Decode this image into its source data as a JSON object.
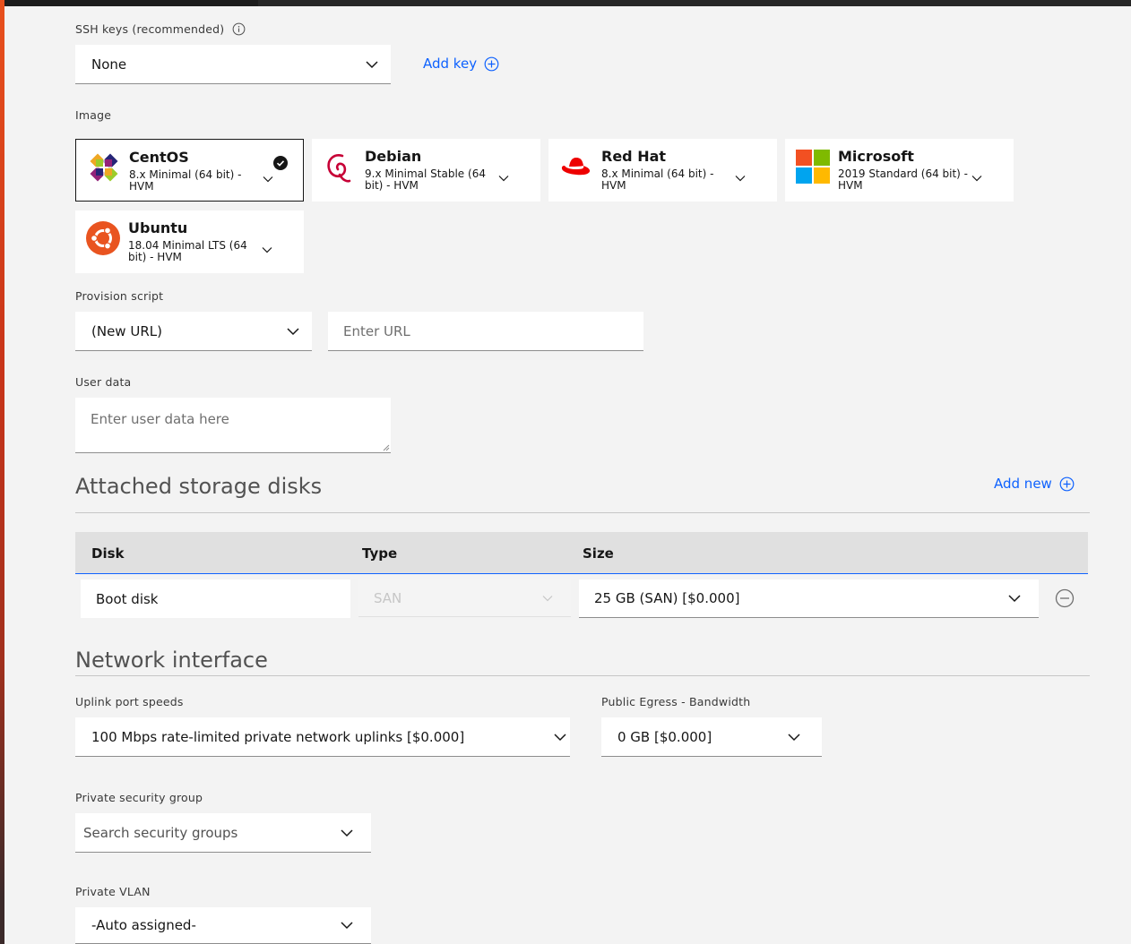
{
  "ssh": {
    "label": "SSH keys (recommended)",
    "value": "None",
    "add_key": "Add key"
  },
  "image": {
    "label": "Image",
    "options": [
      {
        "name": "CentOS",
        "desc": "8.x Minimal (64 bit) - HVM",
        "selected": true
      },
      {
        "name": "Debian",
        "desc": "9.x Minimal Stable (64 bit) - HVM",
        "selected": false
      },
      {
        "name": "Red Hat",
        "desc": "8.x Minimal (64 bit) - HVM",
        "selected": false
      },
      {
        "name": "Microsoft",
        "desc": "2019 Standard (64 bit) - HVM",
        "selected": false
      },
      {
        "name": "Ubuntu",
        "desc": "18.04 Minimal LTS (64 bit) - HVM",
        "selected": false
      }
    ]
  },
  "provision": {
    "label": "Provision script",
    "value": "(New URL)",
    "url_placeholder": "Enter URL"
  },
  "user_data": {
    "label": "User data",
    "placeholder": "Enter user data here"
  },
  "storage": {
    "title": "Attached storage disks",
    "add_new": "Add new",
    "columns": [
      "Disk",
      "Type",
      "Size"
    ],
    "rows": [
      {
        "disk": "Boot disk",
        "type": "SAN",
        "size": "25 GB (SAN) [$0.000]"
      }
    ]
  },
  "network": {
    "title": "Network interface",
    "uplink_label": "Uplink port speeds",
    "uplink_value": "100 Mbps rate-limited private network uplinks [$0.000]",
    "egress_label": "Public Egress - Bandwidth",
    "egress_value": "0 GB [$0.000]",
    "security_label": "Private security group",
    "security_placeholder": "Search security groups",
    "vlan_label": "Private VLAN",
    "vlan_value": "-Auto assigned-"
  },
  "colors": {
    "link": "#0f62fe",
    "background": "#f3f3f3"
  }
}
